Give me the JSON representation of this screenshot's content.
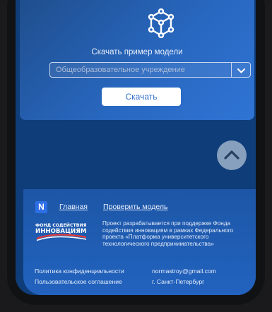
{
  "card": {
    "title": "Скачать пример модели",
    "select_placeholder": "Общеобразовательное учреждение",
    "download_label": "Скачать",
    "icon": "cube-network-icon"
  },
  "scroll_top": {
    "icon": "chevron-up-icon"
  },
  "footer": {
    "logo": "N",
    "nav": [
      "Главная",
      "Проверить модель"
    ],
    "fund_logo_lines": [
      "ФОНД СОДЕЙСТВИЯ",
      "ИННОВАЦИЯМ"
    ],
    "support_text": "Проект разрабатывается при поддержке Фонда содействия инновациям в рамках Федерального проекта «Платформа университетского технологического предпринимательства»",
    "privacy": "Политика конфиденциальности",
    "agreement": "Пользовательское соглашение",
    "email": "normastroy@gmail.com",
    "city": "г. Санкт-Петербург"
  },
  "colors": {
    "page_bg": "#0f3d79",
    "card_accent": "#2f74d4",
    "footer_bg": "#1d56a6",
    "button_text": "#2f6fce"
  }
}
